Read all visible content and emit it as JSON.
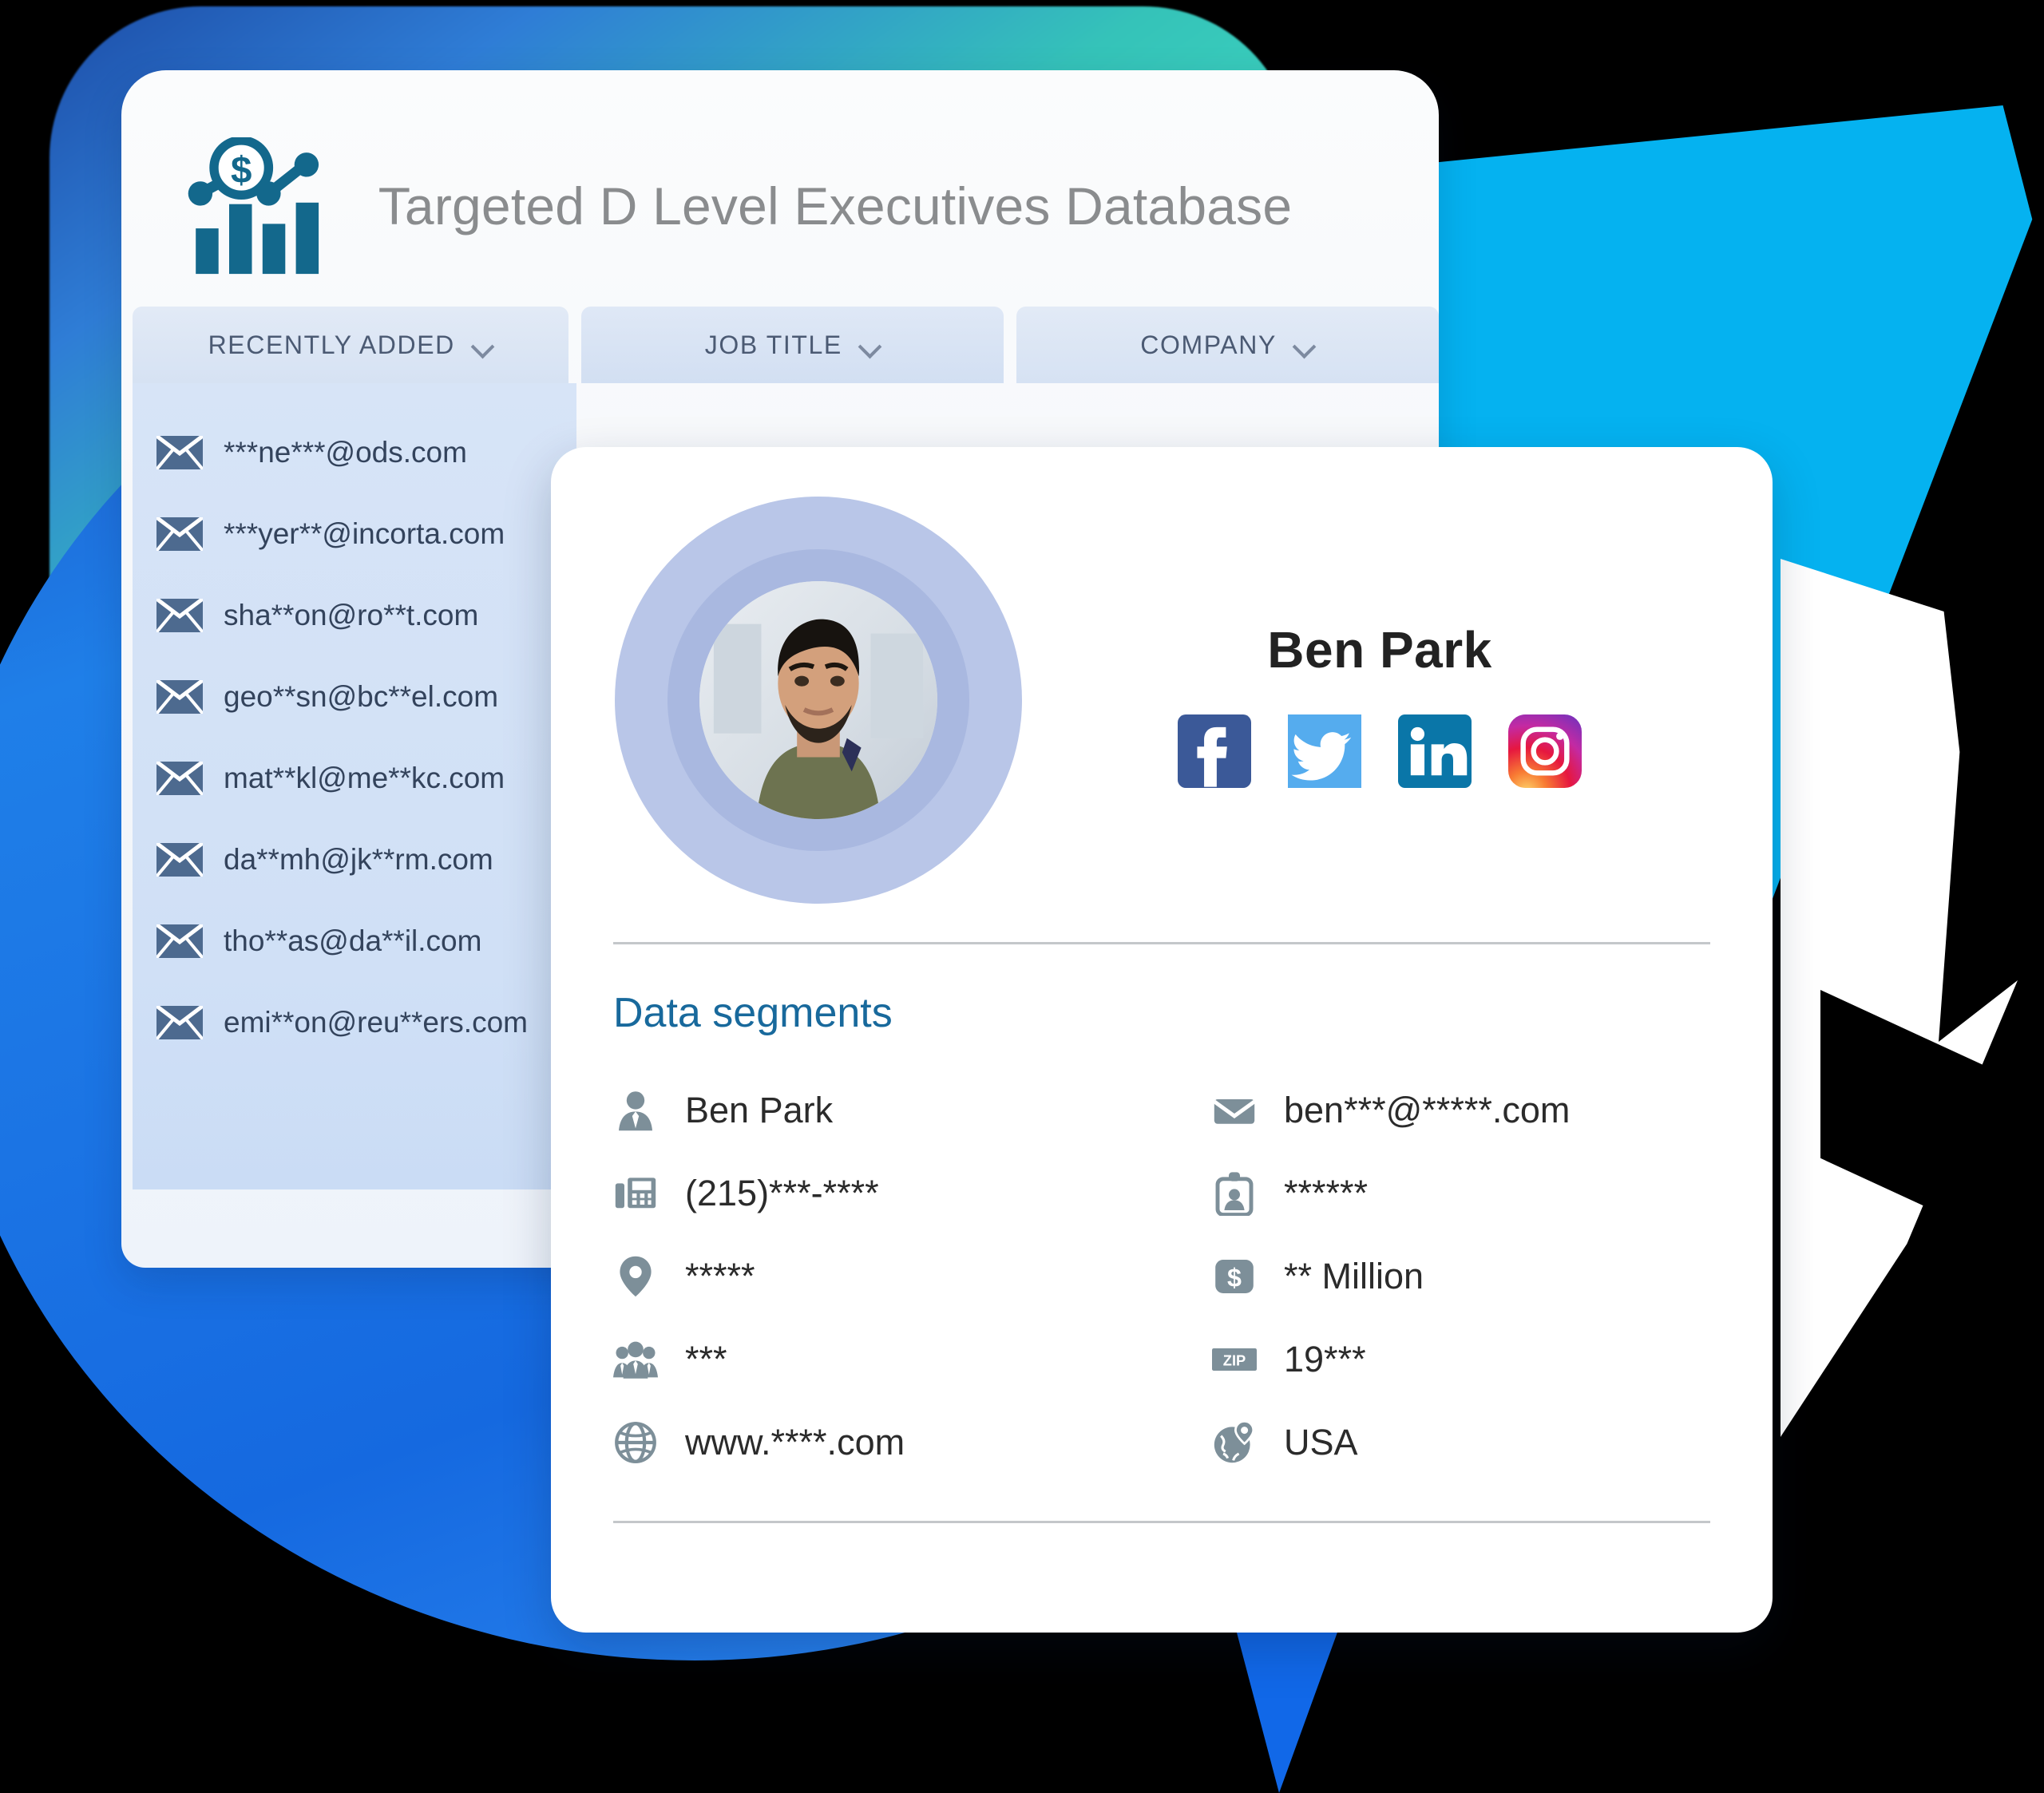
{
  "app": {
    "title": "Targeted D Level Executives Database",
    "logo_icon": "bar-chart-dollar-icon"
  },
  "tabs": [
    {
      "label": "RECENTLY ADDED",
      "chevron_icon": "chevron-down-icon"
    },
    {
      "label": "JOB TITLE",
      "chevron_icon": "chevron-down-icon"
    },
    {
      "label": "COMPANY",
      "chevron_icon": "chevron-down-icon"
    }
  ],
  "email_list": {
    "row_icon": "envelope-icon",
    "items": [
      "***ne***@ods.com",
      "***yer**@incorta.com",
      "sha**on@ro**t.com",
      "geo**sn@bc**el.com",
      "mat**kl@me**kc.com",
      "da**mh@jk**rm.com",
      "tho**as@da**il.com",
      "emi**on@reu**ers.com"
    ]
  },
  "profile": {
    "name": "Ben Park",
    "avatar_icon": "user-photo",
    "socials": [
      {
        "name": "facebook",
        "label": "Facebook",
        "color": "#3b5998"
      },
      {
        "name": "twitter",
        "label": "Twitter",
        "color": "#55acee"
      },
      {
        "name": "linkedin",
        "label": "LinkedIn",
        "color": "#0a76a8"
      },
      {
        "name": "instagram",
        "label": "Instagram",
        "color": "#d6249f"
      }
    ],
    "segments_heading": "Data segments",
    "segments_left": [
      {
        "icon": "person-icon",
        "value": "Ben Park"
      },
      {
        "icon": "fax-phone-icon",
        "value": "(215)***-****"
      },
      {
        "icon": "map-pin-icon",
        "value": "*****"
      },
      {
        "icon": "people-icon",
        "value": "***"
      },
      {
        "icon": "globe-icon",
        "value": "www.****.com"
      }
    ],
    "segments_right": [
      {
        "icon": "envelope-icon",
        "value": "ben***@*****.com"
      },
      {
        "icon": "id-badge-icon",
        "value": "******"
      },
      {
        "icon": "dollar-icon",
        "value": "** Million"
      },
      {
        "icon": "zip-icon",
        "value": "19***"
      },
      {
        "icon": "globe-pin-icon",
        "value": "USA"
      }
    ]
  },
  "theme": {
    "accent_blue": "#18699c",
    "brand_teal": "#3fd9c0",
    "brand_blue": "#1168e8",
    "cyan": "#05b2f0",
    "panel_blue": "#d0e0f6",
    "icon_gray": "#7d8f99"
  }
}
